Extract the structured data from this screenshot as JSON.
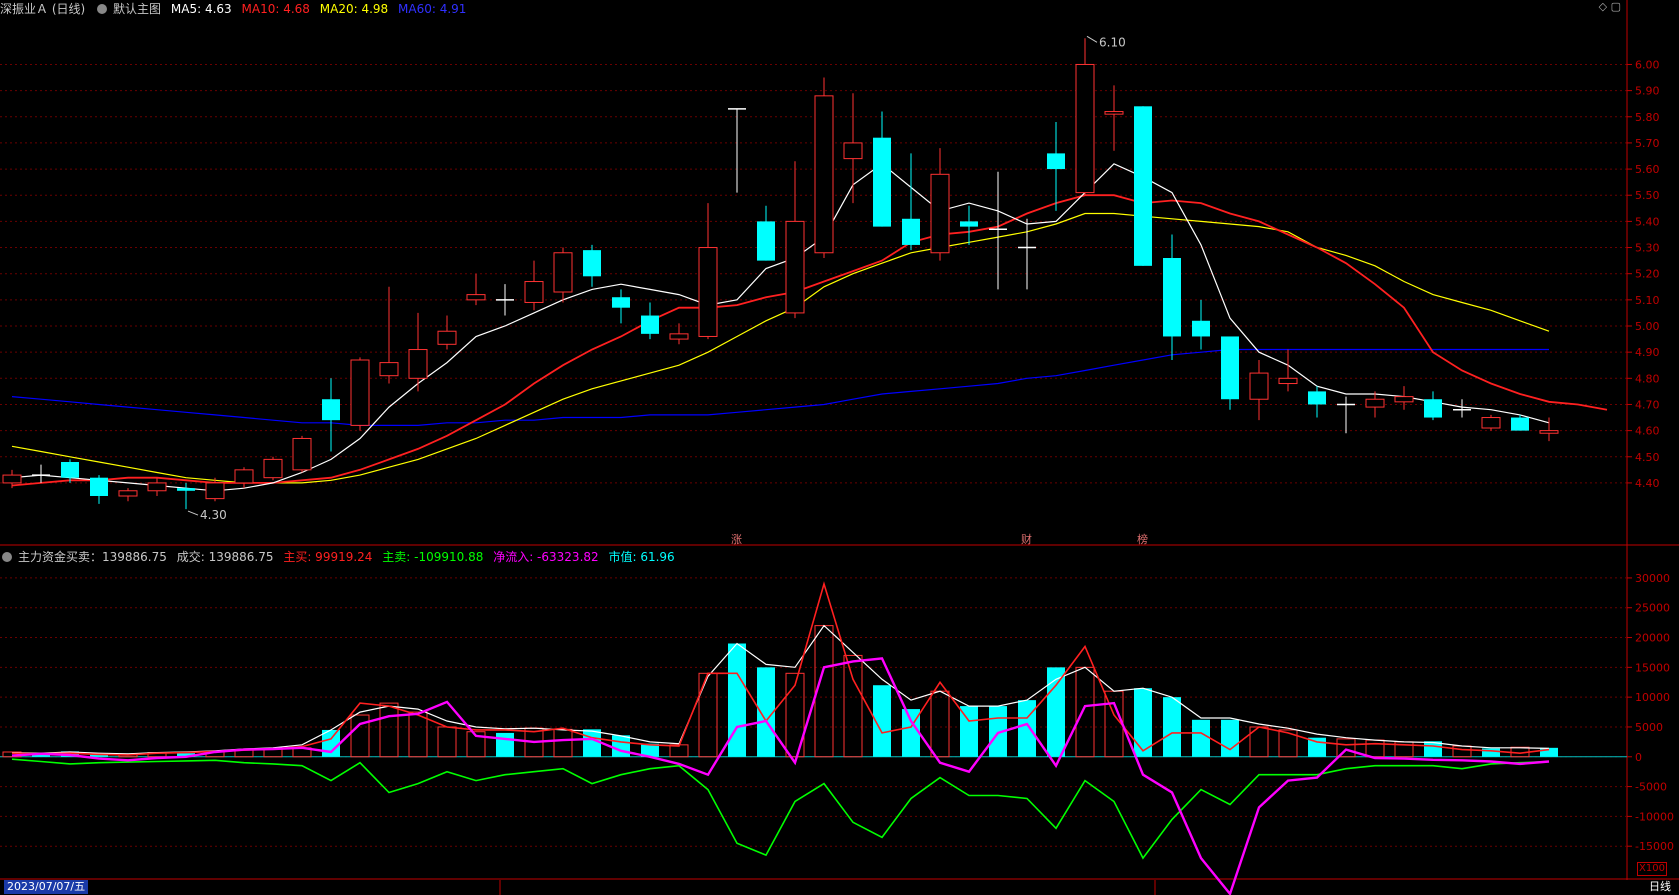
{
  "header": {
    "name": "深振业Ａ",
    "period": "(日线)",
    "chart_title": "默认主图",
    "ma5": "MA5: 4.63",
    "ma10": "MA10: 4.68",
    "ma20": "MA20: 4.98",
    "ma60": "MA60: 4.91"
  },
  "indicator_header": {
    "name": "主力资金买卖：139886.75",
    "volume": "成交: 139886.75",
    "buy": "主买: 99919.24",
    "sell": "主卖: -109910.88",
    "net": "净流入: -63323.82",
    "mkt": "市值: 61.96"
  },
  "footer": {
    "date": "2023/07/07/五",
    "period_label": "日线",
    "scale_badge": "X100"
  },
  "colors": {
    "up": "#ff3232",
    "down": "#00ffff",
    "doji": "#ffffff",
    "ma5": "#ffffff",
    "ma10": "#ff2020",
    "ma20": "#ffff00",
    "ma60": "#0000ff",
    "buy": "#ff2020",
    "sell": "#00ff00",
    "net": "#ff00ff",
    "grid": "#6a0000",
    "axis": "#c00000"
  },
  "chart_data": [
    {
      "type": "candlestick",
      "ylim": [
        4.22,
        6.17
      ],
      "y_ticks": [
        "4.40",
        "4.50",
        "4.60",
        "4.70",
        "4.80",
        "4.90",
        "5.00",
        "5.10",
        "5.20",
        "5.30",
        "5.40",
        "5.50",
        "5.60",
        "5.70",
        "5.80",
        "5.90",
        "6.00"
      ],
      "candles": [
        [
          4.4,
          4.45,
          4.38,
          4.43
        ],
        [
          4.43,
          4.47,
          4.4,
          4.43
        ],
        [
          4.48,
          4.49,
          4.4,
          4.42
        ],
        [
          4.42,
          4.43,
          4.32,
          4.35
        ],
        [
          4.35,
          4.38,
          4.33,
          4.37
        ],
        [
          4.37,
          4.42,
          4.35,
          4.4
        ],
        [
          4.38,
          4.4,
          4.3,
          4.37
        ],
        [
          4.34,
          4.42,
          4.33,
          4.4
        ],
        [
          4.4,
          4.46,
          4.38,
          4.45
        ],
        [
          4.42,
          4.5,
          4.41,
          4.49
        ],
        [
          4.45,
          4.58,
          4.44,
          4.57
        ],
        [
          4.72,
          4.8,
          4.52,
          4.64
        ],
        [
          4.62,
          4.88,
          4.6,
          4.87
        ],
        [
          4.81,
          5.15,
          4.78,
          4.86
        ],
        [
          4.8,
          5.05,
          4.75,
          4.91
        ],
        [
          4.93,
          5.04,
          4.91,
          4.98
        ],
        [
          5.1,
          5.2,
          5.08,
          5.12
        ],
        [
          5.1,
          5.16,
          5.04,
          5.1
        ],
        [
          5.09,
          5.25,
          5.06,
          5.17
        ],
        [
          5.13,
          5.3,
          5.09,
          5.28
        ],
        [
          5.29,
          5.31,
          5.15,
          5.19
        ],
        [
          5.11,
          5.14,
          5.01,
          5.07
        ],
        [
          5.04,
          5.09,
          4.95,
          4.97
        ],
        [
          4.95,
          5.01,
          4.93,
          4.97
        ],
        [
          4.96,
          5.47,
          4.95,
          5.3
        ],
        [
          5.83,
          5.83,
          5.51,
          5.83
        ],
        [
          5.4,
          5.46,
          5.25,
          5.25
        ],
        [
          5.05,
          5.63,
          5.03,
          5.4
        ],
        [
          5.28,
          5.95,
          5.26,
          5.88
        ],
        [
          5.64,
          5.89,
          5.47,
          5.7
        ],
        [
          5.72,
          5.82,
          5.38,
          5.38
        ],
        [
          5.41,
          5.66,
          5.29,
          5.31
        ],
        [
          5.28,
          5.68,
          5.25,
          5.58
        ],
        [
          5.4,
          5.46,
          5.31,
          5.38
        ],
        [
          5.37,
          5.59,
          5.14,
          5.37
        ],
        [
          5.3,
          5.41,
          5.14,
          5.3
        ],
        [
          5.66,
          5.78,
          5.44,
          5.6
        ],
        [
          5.51,
          6.1,
          5.5,
          6.0
        ],
        [
          5.81,
          5.92,
          5.67,
          5.82
        ],
        [
          5.84,
          5.84,
          5.23,
          5.23
        ],
        [
          5.26,
          5.35,
          4.87,
          4.96
        ],
        [
          5.02,
          5.1,
          4.91,
          4.96
        ],
        [
          4.96,
          4.96,
          4.68,
          4.72
        ],
        [
          4.72,
          4.87,
          4.64,
          4.82
        ],
        [
          4.78,
          4.91,
          4.75,
          4.8
        ],
        [
          4.75,
          4.77,
          4.65,
          4.7
        ],
        [
          4.7,
          4.73,
          4.59,
          4.7
        ],
        [
          4.69,
          4.75,
          4.65,
          4.72
        ],
        [
          4.71,
          4.77,
          4.68,
          4.73
        ],
        [
          4.72,
          4.75,
          4.64,
          4.65
        ],
        [
          4.68,
          4.72,
          4.65,
          4.68
        ],
        [
          4.61,
          4.66,
          4.6,
          4.65
        ],
        [
          4.65,
          4.66,
          4.6,
          4.6
        ],
        [
          4.59,
          4.65,
          4.56,
          4.6
        ]
      ],
      "ma5": [
        4.42,
        4.43,
        4.42,
        4.41,
        4.4,
        4.39,
        4.38,
        4.37,
        4.38,
        4.4,
        4.44,
        4.49,
        4.57,
        4.69,
        4.78,
        4.86,
        4.96,
        5.0,
        5.05,
        5.1,
        5.14,
        5.16,
        5.14,
        5.12,
        5.08,
        5.1,
        5.22,
        5.26,
        5.34,
        5.54,
        5.62,
        5.53,
        5.44,
        5.47,
        5.44,
        5.39,
        5.4,
        5.51,
        5.62,
        5.57,
        5.51,
        5.31,
        5.03,
        4.9,
        4.85,
        4.77,
        4.74,
        4.74,
        4.73,
        4.71,
        4.69,
        4.68,
        4.66,
        4.63
      ],
      "ma10": [
        4.39,
        4.4,
        4.41,
        4.41,
        4.42,
        4.42,
        4.41,
        4.4,
        4.4,
        4.4,
        4.41,
        4.42,
        4.45,
        4.49,
        4.53,
        4.58,
        4.64,
        4.7,
        4.78,
        4.85,
        4.91,
        4.96,
        5.02,
        5.07,
        5.07,
        5.08,
        5.11,
        5.13,
        5.17,
        5.21,
        5.25,
        5.32,
        5.35,
        5.36,
        5.38,
        5.43,
        5.47,
        5.5,
        5.5,
        5.47,
        5.48,
        5.47,
        5.43,
        5.4,
        5.35,
        5.3,
        5.24,
        5.16,
        5.07,
        4.9,
        4.83,
        4.78,
        4.74,
        4.71,
        4.7,
        4.68
      ],
      "ma20": [
        4.54,
        4.52,
        4.5,
        4.48,
        4.46,
        4.44,
        4.42,
        4.41,
        4.4,
        4.4,
        4.4,
        4.41,
        4.43,
        4.46,
        4.49,
        4.53,
        4.57,
        4.62,
        4.67,
        4.72,
        4.76,
        4.79,
        4.82,
        4.85,
        4.9,
        4.96,
        5.02,
        5.07,
        5.15,
        5.2,
        5.24,
        5.28,
        5.3,
        5.32,
        5.34,
        5.36,
        5.39,
        5.43,
        5.43,
        5.42,
        5.41,
        5.4,
        5.39,
        5.38,
        5.36,
        5.3,
        5.27,
        5.23,
        5.17,
        5.12,
        5.09,
        5.06,
        5.02,
        4.98
      ],
      "ma60": [
        4.73,
        4.72,
        4.71,
        4.7,
        4.69,
        4.68,
        4.67,
        4.66,
        4.65,
        4.64,
        4.63,
        4.63,
        4.62,
        4.62,
        4.62,
        4.63,
        4.63,
        4.64,
        4.64,
        4.65,
        4.65,
        4.65,
        4.66,
        4.66,
        4.66,
        4.67,
        4.68,
        4.69,
        4.7,
        4.72,
        4.74,
        4.75,
        4.76,
        4.77,
        4.78,
        4.8,
        4.81,
        4.83,
        4.85,
        4.87,
        4.89,
        4.9,
        4.91,
        4.91,
        4.91,
        4.91,
        4.91,
        4.91,
        4.91,
        4.91,
        4.91,
        4.91,
        4.91,
        4.91
      ],
      "annotations": [
        {
          "label": "6.10",
          "index": 37,
          "value": 6.1
        },
        {
          "label": "4.30",
          "index": 6,
          "value": 4.3
        }
      ],
      "markers": [
        {
          "index": 25,
          "label": "涨"
        },
        {
          "index": 35,
          "label": "财"
        },
        {
          "index": 39,
          "label": "榜"
        }
      ]
    },
    {
      "type": "bar+line",
      "ylim": [
        -20000,
        32000
      ],
      "y_ticks": [
        "30000",
        "25000",
        "20000",
        "15000",
        "10000",
        "5000",
        "0",
        "-5000",
        "-10000",
        "-15000"
      ],
      "volume_bars": [
        800,
        600,
        900,
        500,
        400,
        700,
        600,
        900,
        1200,
        1300,
        1500,
        4500,
        7000,
        9000,
        7500,
        5000,
        4200,
        4000,
        4800,
        4600,
        4600,
        3600,
        2200,
        2000,
        14000,
        19000,
        15000,
        14000,
        22000,
        17000,
        12000,
        8000,
        11000,
        8500,
        8500,
        9500,
        15000,
        15000,
        11000,
        11500,
        10000,
        6200,
        6200,
        5000,
        4500,
        3200,
        3000,
        2800,
        2500,
        2600,
        1800,
        1400,
        1600,
        1500
      ],
      "bar_up": [
        true,
        false,
        false,
        false,
        true,
        true,
        false,
        true,
        true,
        true,
        true,
        false,
        true,
        true,
        true,
        true,
        true,
        false,
        true,
        true,
        false,
        false,
        false,
        true,
        true,
        false,
        false,
        true,
        true,
        true,
        false,
        false,
        true,
        false,
        false,
        false,
        false,
        true,
        true,
        false,
        false,
        false,
        false,
        true,
        true,
        false,
        true,
        true,
        true,
        false,
        true,
        false,
        true,
        false
      ],
      "white_line": [
        700,
        600,
        800,
        600,
        500,
        700,
        800,
        1000,
        1300,
        1500,
        2000,
        4500,
        7500,
        8500,
        8000,
        6000,
        5000,
        4700,
        4800,
        4500,
        4300,
        3500,
        2500,
        2200,
        13500,
        19000,
        15500,
        15000,
        22000,
        17500,
        13000,
        9500,
        11000,
        8500,
        8500,
        9500,
        13000,
        15000,
        11000,
        11500,
        10000,
        6500,
        6500,
        5500,
        4800,
        3800,
        3200,
        2800,
        2500,
        2400,
        1800,
        1500,
        1500,
        1400
      ],
      "buy_line": [
        600,
        500,
        600,
        400,
        300,
        600,
        700,
        900,
        1100,
        1300,
        1700,
        3000,
        9000,
        8500,
        7000,
        5000,
        4500,
        4500,
        4200,
        4800,
        3200,
        2500,
        2000,
        1800,
        14000,
        14000,
        6000,
        12000,
        29000,
        13000,
        4000,
        5000,
        12500,
        6000,
        6500,
        6500,
        12000,
        18500,
        7000,
        1000,
        4000,
        4000,
        1200,
        5000,
        4000,
        2500,
        2000,
        2200,
        2000,
        1800,
        1200,
        1000,
        600,
        1200
      ],
      "sell_line": [
        -400,
        -800,
        -1200,
        -1000,
        -900,
        -800,
        -700,
        -600,
        -1000,
        -1200,
        -1500,
        -4000,
        -1000,
        -6000,
        -4500,
        -2500,
        -4000,
        -3000,
        -2500,
        -2000,
        -4500,
        -3000,
        -2000,
        -1500,
        -5500,
        -14500,
        -16500,
        -7500,
        -4500,
        -11000,
        -13500,
        -7000,
        -3500,
        -6500,
        -6500,
        -7000,
        -12000,
        -4000,
        -7500,
        -17000,
        -10500,
        -5500,
        -8000,
        -3000,
        -3000,
        -3000,
        -2000,
        -1500,
        -1500,
        -1500,
        -2000,
        -1200,
        -1000,
        -800
      ],
      "net_line": [
        200,
        500,
        300,
        -300,
        -600,
        -200,
        0,
        800,
        1200,
        1300,
        1500,
        800,
        5500,
        6800,
        7200,
        9200,
        3500,
        3000,
        2500,
        2800,
        3000,
        1000,
        0,
        -1200,
        -3000,
        5000,
        6000,
        -1000,
        15000,
        16000,
        16500,
        6000,
        -1000,
        -2500,
        4000,
        5500,
        -1500,
        8500,
        9000,
        -3000,
        -6000,
        -17000,
        -23000,
        -8500,
        -4000,
        -3500,
        1200,
        -200,
        -300,
        -500,
        -600,
        -800,
        -1200,
        -800
      ]
    }
  ]
}
